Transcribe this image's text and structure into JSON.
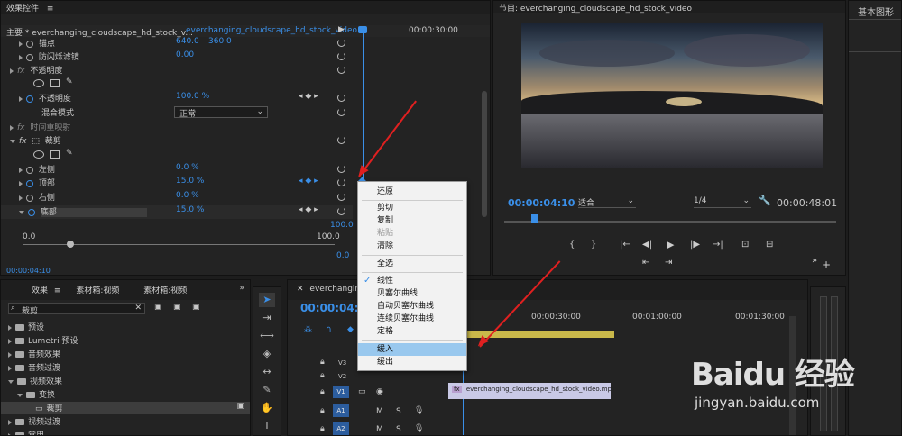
{
  "effect_controls": {
    "title": "效果控件",
    "source_label": "主要 * everchanging_cloudscape_hd_stock_v...",
    "clip_label": "everchanging_cloudscape_hd_stock_video...",
    "ruler_time": "00:00:30:00",
    "timecode": "00:00:04:10",
    "rows": [
      {
        "label": "锚点",
        "v1": "640.0",
        "v2": "360.0"
      },
      {
        "label": "防闪烁滤镜",
        "v1": "0.00",
        "v2": ""
      },
      {
        "label": "不透明度",
        "v1": "",
        "v2": ""
      },
      {
        "label": "不透明度",
        "v1": "100.0 %",
        "v2": ""
      },
      {
        "label": "混合模式",
        "v1": "正常",
        "v2": ""
      },
      {
        "label": "时间重映射",
        "v1": "",
        "v2": ""
      },
      {
        "label": "裁剪",
        "v1": "",
        "v2": ""
      },
      {
        "label": "左侧",
        "v1": "0.0 %",
        "v2": ""
      },
      {
        "label": "顶部",
        "v1": "15.0 %",
        "v2": ""
      },
      {
        "label": "右侧",
        "v1": "0.0 %",
        "v2": ""
      },
      {
        "label": "底部",
        "v1": "15.0 %",
        "v2": ""
      }
    ],
    "graph_top": "100.0",
    "graph_min": "0.0",
    "graph_max": "100.0",
    "graph_bottom": "0.0"
  },
  "program_monitor": {
    "title": "节目: everchanging_cloudscape_hd_stock_video",
    "current_time": "00:00:04:10",
    "fit": "适合",
    "resolution": "1/4",
    "duration": "00:00:48:01"
  },
  "essential_graphics": {
    "title": "基本图形"
  },
  "context_menu": {
    "items": [
      {
        "label": "还原",
        "state": "normal"
      },
      {
        "label": "剪切",
        "state": "normal"
      },
      {
        "label": "复制",
        "state": "normal"
      },
      {
        "label": "粘贴",
        "state": "disabled"
      },
      {
        "label": "清除",
        "state": "normal"
      },
      {
        "label": "全选",
        "state": "normal"
      },
      {
        "label": "线性",
        "state": "checked"
      },
      {
        "label": "贝塞尔曲线",
        "state": "normal"
      },
      {
        "label": "自动贝塞尔曲线",
        "state": "normal"
      },
      {
        "label": "连续贝塞尔曲线",
        "state": "normal"
      },
      {
        "label": "定格",
        "state": "normal"
      },
      {
        "label": "缓入",
        "state": "highlighted"
      },
      {
        "label": "缓出",
        "state": "normal"
      }
    ]
  },
  "effects_panel": {
    "tabs": [
      "效果",
      "素材箱:视频",
      "素材箱:视频"
    ],
    "search_value": "裁剪",
    "tree": [
      {
        "label": "预设"
      },
      {
        "label": "Lumetri 预设"
      },
      {
        "label": "音频效果"
      },
      {
        "label": "音频过渡"
      },
      {
        "label": "视频效果"
      },
      {
        "label": "变换"
      },
      {
        "label": "裁剪"
      },
      {
        "label": "视频过渡"
      },
      {
        "label": "常用"
      }
    ]
  },
  "timeline": {
    "tab": "everchanging_c",
    "timecode": "00:00:04:1",
    "ruler": [
      "00:00:30:00",
      "00:01:00:00",
      "00:01:30:00"
    ],
    "tracks": [
      "V3",
      "V2",
      "V1",
      "A1",
      "A2"
    ],
    "clip_label": "everchanging_cloudscape_hd_stock_video.mp4",
    "m_label": "M",
    "s_label": "S"
  },
  "watermark": {
    "brand": "Baidu 经验",
    "url": "jingyan.baidu.com"
  }
}
